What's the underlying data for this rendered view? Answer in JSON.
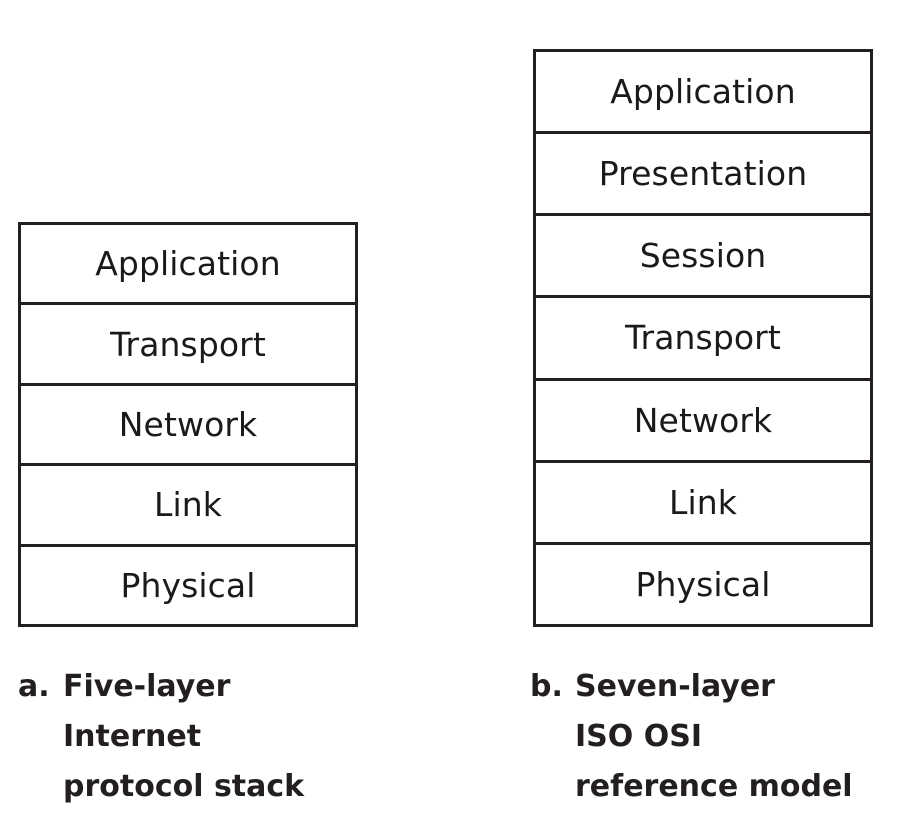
{
  "figure": {
    "background_color": "#ffffff",
    "line_color": "#231f20",
    "text_color": "#1a1a1a"
  },
  "stacks": [
    {
      "id": "five-layer-internet-protocol-stack",
      "layers": [
        {
          "name": "Application"
        },
        {
          "name": "Transport"
        },
        {
          "name": "Network"
        },
        {
          "name": "Link"
        },
        {
          "name": "Physical"
        }
      ],
      "caption": {
        "marker": "a.",
        "lines": [
          "Five-layer",
          "Internet",
          "protocol stack"
        ]
      }
    },
    {
      "id": "seven-layer-iso-osi-reference-model",
      "layers": [
        {
          "name": "Application"
        },
        {
          "name": "Presentation"
        },
        {
          "name": "Session"
        },
        {
          "name": "Transport"
        },
        {
          "name": "Network"
        },
        {
          "name": "Link"
        },
        {
          "name": "Physical"
        }
      ],
      "caption": {
        "marker": "b.",
        "lines": [
          "Seven-layer",
          "ISO OSI",
          "reference model"
        ]
      }
    }
  ]
}
